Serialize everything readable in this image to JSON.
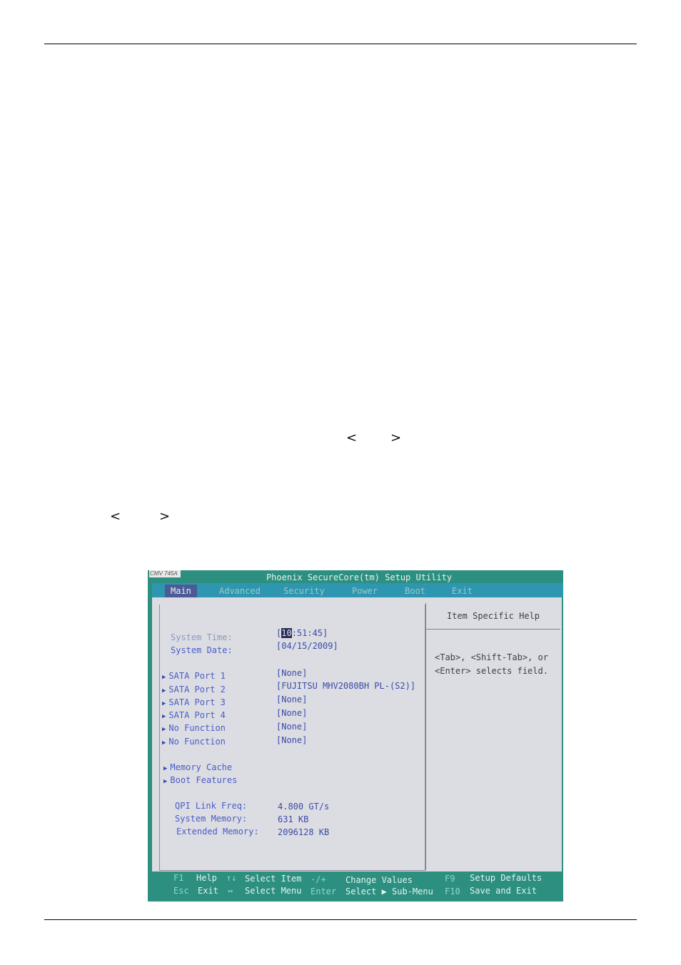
{
  "document": {
    "angle_pair_1": {
      "left": "<",
      "right": ">"
    },
    "angle_pair_2": {
      "left": "<",
      "right": ">"
    }
  },
  "photo": {
    "camera_label": "CMV 745A",
    "bios": {
      "title": "Phoenix SecureCore(tm) Setup Utility",
      "tabs": [
        "Main",
        "Advanced",
        "Security",
        "Power",
        "Boot",
        "Exit"
      ],
      "active_tab": "Main",
      "items": [
        {
          "label": "System Time:",
          "value_cursor": "10",
          "value_rest": ":51:45]",
          "value_prefix": "["
        },
        {
          "label": "System Date:",
          "value": "[04/15/2009]"
        }
      ],
      "ports": [
        {
          "label": "SATA Port 1",
          "value": "[None]"
        },
        {
          "label": "SATA Port 2",
          "value": "[FUJITSU MHV2080BH PL-(S2)]"
        },
        {
          "label": "SATA Port 3",
          "value": "[None]"
        },
        {
          "label": "SATA Port 4",
          "value": "[None]"
        },
        {
          "label": "No Function",
          "value": "[None]"
        },
        {
          "label": "No Function",
          "value": "[None]"
        }
      ],
      "submenus": [
        "Memory Cache",
        "Boot Features"
      ],
      "info": [
        {
          "label": "QPI Link Freq:",
          "value": "4.800 GT/s"
        },
        {
          "label": "System Memory:",
          "value": "631 KB"
        },
        {
          "label": "Extended Memory:",
          "value": "2096128 KB"
        }
      ],
      "help": {
        "title": "Item Specific Help",
        "text": "<Tab>, <Shift-Tab>, or <Enter> selects field."
      },
      "status": {
        "f1_key": "F1",
        "f1_desc": "Help",
        "updown_key": "↑↓",
        "updown_desc": "Select Item",
        "minusplus_key": "-/+",
        "minusplus_desc": "Change Values",
        "f9_key": "F9",
        "f9_desc": "Setup Defaults",
        "esc_key": "Esc",
        "esc_desc": "Exit",
        "leftright_key": "↔",
        "leftright_desc": "Select Menu",
        "enter_key": "Enter",
        "enter_desc": "Select ▶ Sub-Menu",
        "f10_key": "F10",
        "f10_desc": "Save and Exit"
      }
    }
  }
}
